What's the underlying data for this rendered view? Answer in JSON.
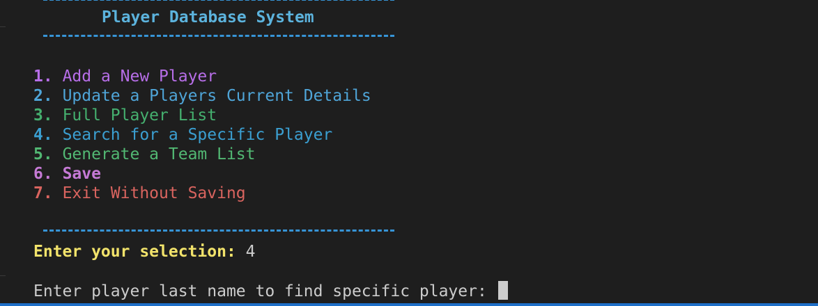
{
  "terminal": {
    "title": "Player Database System",
    "menu": [
      {
        "num": "1.",
        "label": "Add a New Player",
        "color": "#b76ee8",
        "bold": false
      },
      {
        "num": "2.",
        "label": "Update a Players Current Details",
        "color": "#4fa5d8",
        "bold": false
      },
      {
        "num": "3.",
        "label": "Full Player List",
        "color": "#45b06f",
        "bold": false
      },
      {
        "num": "4.",
        "label": "Search for a Specific Player",
        "color": "#3b9fd1",
        "bold": false
      },
      {
        "num": "5.",
        "label": "Generate a Team List",
        "color": "#52b873",
        "bold": false
      },
      {
        "num": "6.",
        "label": "Save",
        "color": "#c67ad6",
        "bold": true
      },
      {
        "num": "7.",
        "label": "Exit Without Saving",
        "color": "#d9645f",
        "bold": false
      }
    ],
    "prompt": {
      "label": "Enter your selection:",
      "value": "4"
    },
    "input_prompt": "Enter player last name to find specific player:"
  },
  "colors": {
    "background": "#1e1e1e",
    "title": "#5cb3dd",
    "rule": "#3794d6",
    "prompt_label": "#f2e36b",
    "text": "#cccccc",
    "cursor": "#cccccc",
    "bottom_bar": "#1e6fc8"
  }
}
